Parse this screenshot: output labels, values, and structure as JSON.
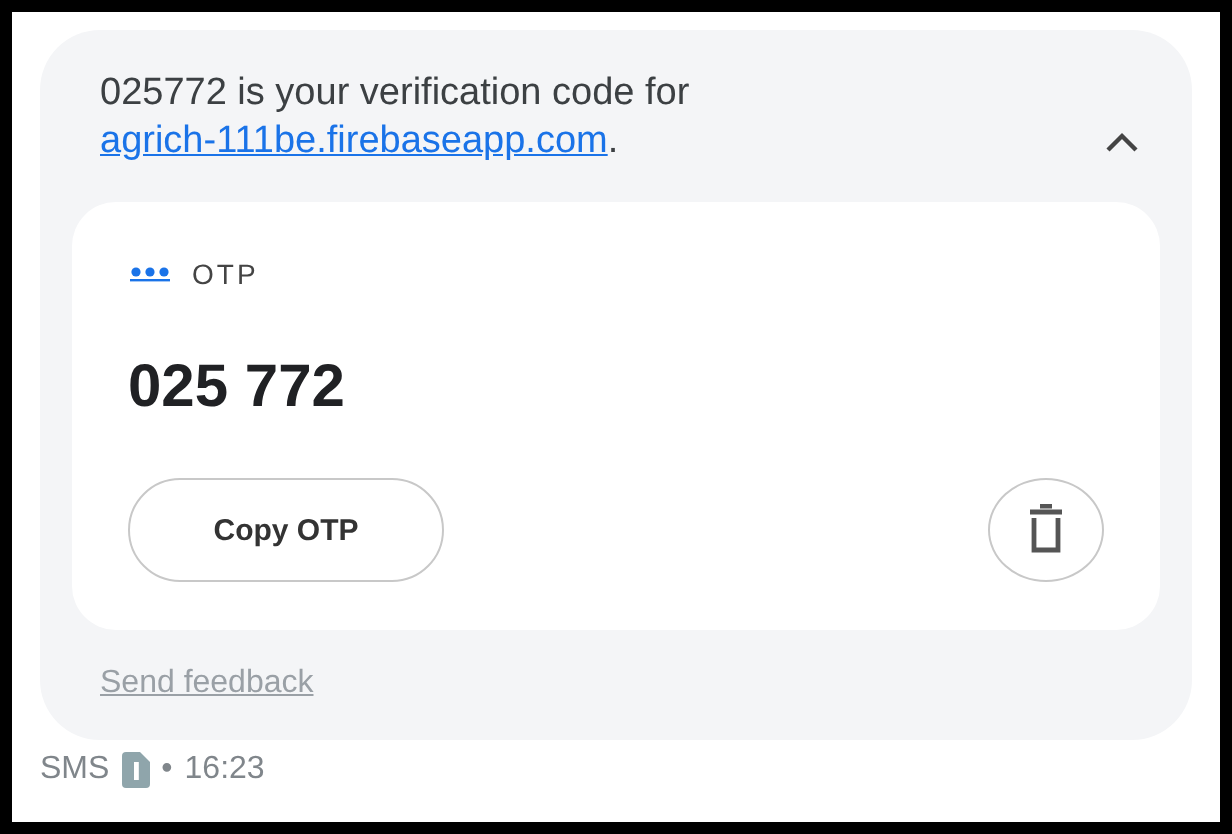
{
  "message": {
    "text": "025772 is your verification code for",
    "link": "agrich-111be.firebaseapp.com",
    "link_suffix": ".",
    "expanded": true
  },
  "otp_card": {
    "label": "OTP",
    "code": "025 772",
    "copy_button": "Copy OTP"
  },
  "feedback_link": "Send feedback",
  "footer": {
    "source": "SMS",
    "separator": "•",
    "time": "16:23"
  }
}
